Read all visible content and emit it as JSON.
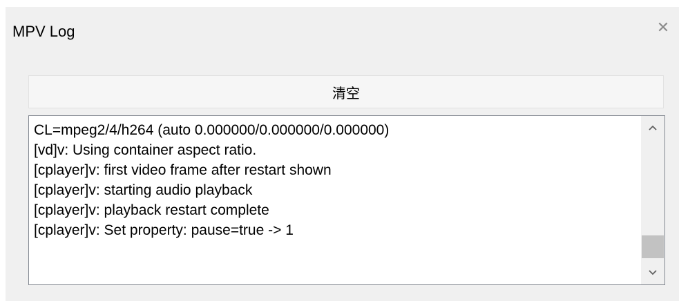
{
  "dialog": {
    "title": "MPV Log",
    "close_icon": "close-icon"
  },
  "toolbar": {
    "clear_label": "清空"
  },
  "log": {
    "lines": [
      "CL=mpeg2/4/h264 (auto 0.000000/0.000000/0.000000)",
      "[vd]v: Using container aspect ratio.",
      "[cplayer]v: first video frame after restart shown",
      "[cplayer]v: starting audio playback",
      "[cplayer]v: playback restart complete",
      "[cplayer]v: Set property: pause=true -> 1"
    ],
    "scrollbar": {
      "up_icon": "chevron-up-icon",
      "down_icon": "chevron-down-icon",
      "position_fraction": 0.85
    }
  }
}
